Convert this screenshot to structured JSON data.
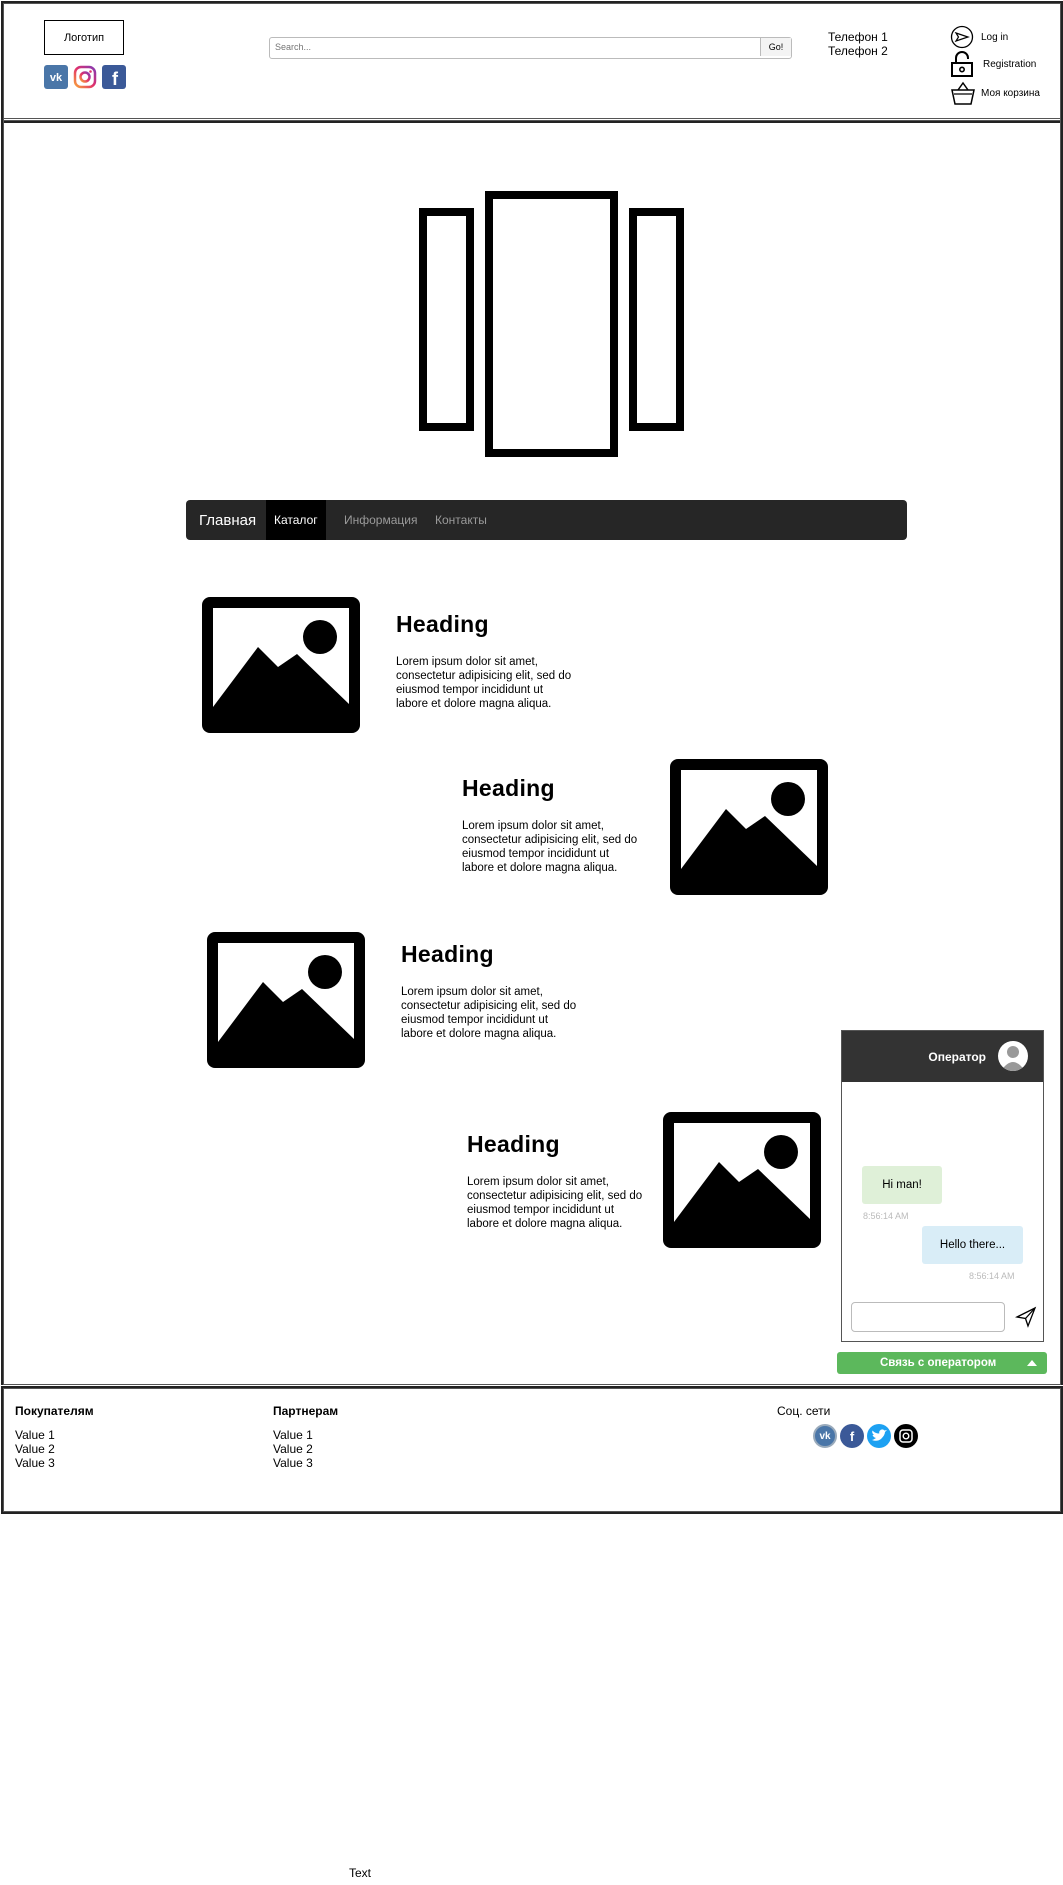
{
  "header": {
    "logo": "Логотип",
    "social": [
      "vk-icon",
      "instagram-icon",
      "facebook-icon"
    ],
    "search": {
      "placeholder": "Search...",
      "button": "Go!"
    },
    "phones": [
      "Телефон 1",
      "Телефон 2"
    ],
    "account": {
      "login": "Log in",
      "registration": "Registration",
      "cart": "Моя корзина"
    }
  },
  "nav": {
    "brand": "Главная",
    "items": [
      "Каталог",
      "Информация",
      "Контакты"
    ],
    "active_index": 0
  },
  "features": [
    {
      "heading": "Heading",
      "text": "Lorem ipsum dolor sit amet, consectetur adipisicing elit, sed do eiusmod tempor incididunt ut labore et dolore magna aliqua."
    },
    {
      "heading": "Heading",
      "text": "Lorem ipsum dolor sit amet, consectetur adipisicing elit, sed do eiusmod tempor incididunt ut labore et dolore magna aliqua."
    },
    {
      "heading": "Heading",
      "text": "Lorem ipsum dolor sit amet, consectetur adipisicing elit, sed do eiusmod tempor incididunt ut labore et dolore magna aliqua."
    },
    {
      "heading": "Heading",
      "text": "Lorem ipsum dolor sit amet, consectetur adipisicing elit, sed do eiusmod tempor incididunt ut labore et dolore magna aliqua."
    }
  ],
  "chat": {
    "title": "Оператор",
    "messages": [
      {
        "from": "operator",
        "text": "Hi man!",
        "time": "8:56:14 AM"
      },
      {
        "from": "user",
        "text": "Hello there...",
        "time": "8:56:14 AM"
      }
    ],
    "toggle_button": "Связь с оператором"
  },
  "footer": {
    "columns": [
      {
        "title": "Покупателям",
        "items": [
          "Value 1",
          "Value 2",
          "Value 3"
        ]
      },
      {
        "title": "Партнерам",
        "items": [
          "Value 1",
          "Value 2",
          "Value 3"
        ]
      }
    ],
    "social_title": "Соц. сети",
    "social": [
      "vk-icon",
      "facebook-icon",
      "twitter-icon",
      "instagram-icon"
    ]
  },
  "bottom_text": "Text",
  "colors": {
    "nav_bg": "#262626",
    "chat_header": "#333333",
    "operator_button": "#5cb85c",
    "bubble_in": "#dff0d8",
    "bubble_out": "#d9edf7"
  }
}
